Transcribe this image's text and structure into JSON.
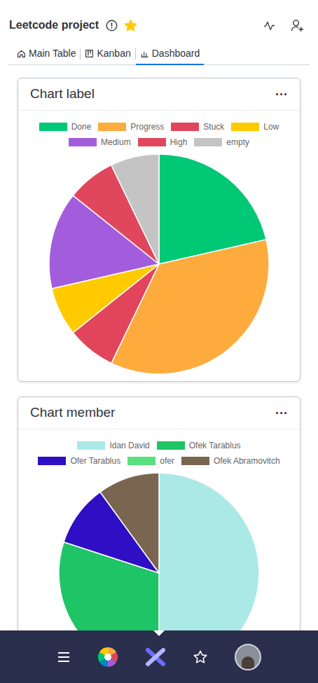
{
  "board": {
    "title": "Leetcode project",
    "starred": true
  },
  "tabs": [
    {
      "label": "Main Table",
      "selected": false
    },
    {
      "label": "Kanban",
      "selected": false
    },
    {
      "label": "Dashboard",
      "selected": true
    }
  ],
  "charts": [
    {
      "title": "Chart label",
      "menu": "···",
      "slices": [
        {
          "label": "Done",
          "value": 3,
          "color": "#00c875"
        },
        {
          "label": "Progress",
          "value": 5,
          "color": "#fdab3d"
        },
        {
          "label": "Stuck",
          "value": 1,
          "color": "#e2445c"
        },
        {
          "label": "Low",
          "value": 1,
          "color": "#ffcb00"
        },
        {
          "label": "Medium",
          "value": 2,
          "color": "#a25ddc"
        },
        {
          "label": "High",
          "value": 1,
          "color": "#e0475d"
        },
        {
          "label": "empty",
          "value": 1,
          "color": "#c4c4c4"
        }
      ]
    },
    {
      "title": "Chart member",
      "menu": "···",
      "slices": [
        {
          "label": "Idan David",
          "value": 5,
          "color": "#abe9e7"
        },
        {
          "label": "Ofek Tarablus",
          "value": 3,
          "color": "#1fc466"
        },
        {
          "label": "Ofer Tarablus",
          "value": 1,
          "color": "#2e0fc4"
        },
        {
          "label": "ofer",
          "value": 0,
          "color": "#5be07e"
        },
        {
          "label": "Ofek Abramovitch",
          "value": 1,
          "color": "#7a6650"
        }
      ]
    }
  ]
}
